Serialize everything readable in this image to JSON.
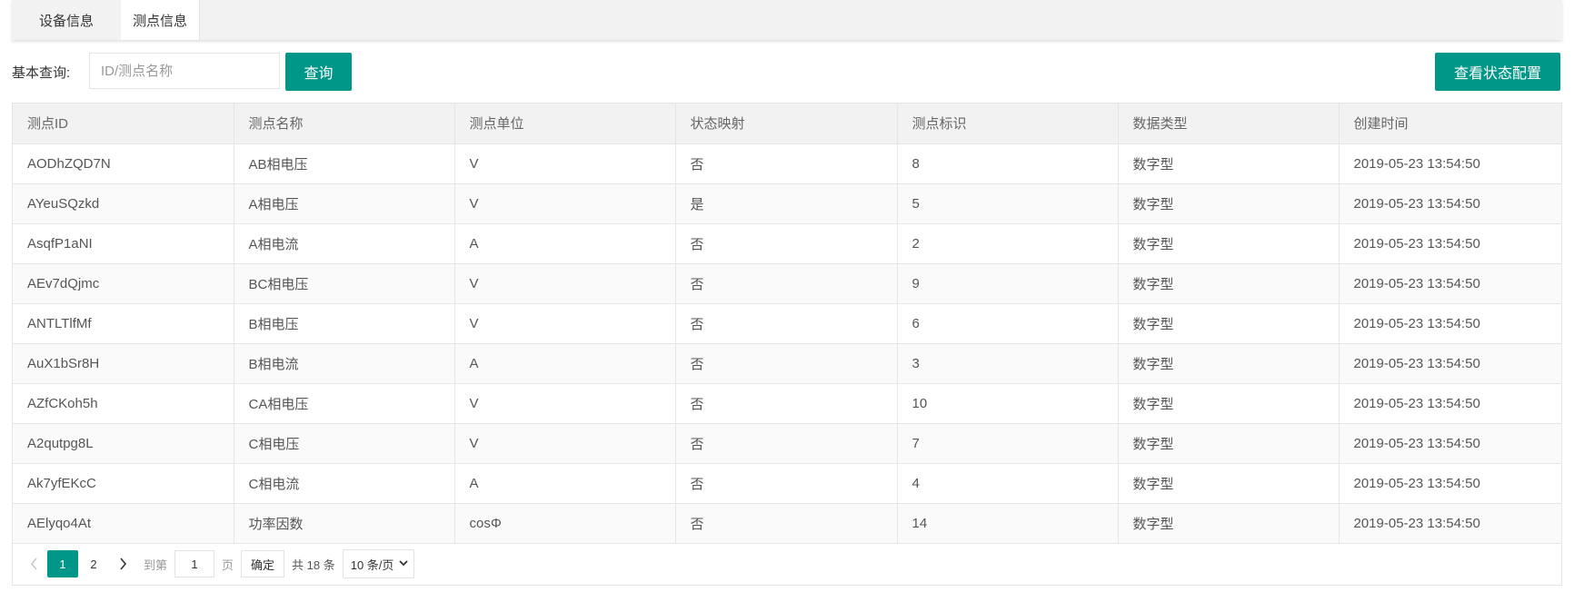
{
  "tabs": [
    {
      "label": "设备信息"
    },
    {
      "label": "测点信息"
    }
  ],
  "query": {
    "label": "基本查询:",
    "placeholder": "ID/测点名称",
    "button_label": "查询"
  },
  "status_config_button": "查看状态配置",
  "table": {
    "headers": [
      "测点ID",
      "测点名称",
      "测点单位",
      "状态映射",
      "测点标识",
      "数据类型",
      "创建时间"
    ],
    "rows": [
      [
        "AODhZQD7N",
        "AB相电压",
        "V",
        "否",
        "8",
        "数字型",
        "2019-05-23 13:54:50"
      ],
      [
        "AYeuSQzkd",
        "A相电压",
        "V",
        "是",
        "5",
        "数字型",
        "2019-05-23 13:54:50"
      ],
      [
        "AsqfP1aNI",
        "A相电流",
        "A",
        "否",
        "2",
        "数字型",
        "2019-05-23 13:54:50"
      ],
      [
        "AEv7dQjmc",
        "BC相电压",
        "V",
        "否",
        "9",
        "数字型",
        "2019-05-23 13:54:50"
      ],
      [
        "ANTLTlfMf",
        "B相电压",
        "V",
        "否",
        "6",
        "数字型",
        "2019-05-23 13:54:50"
      ],
      [
        "AuX1bSr8H",
        "B相电流",
        "A",
        "否",
        "3",
        "数字型",
        "2019-05-23 13:54:50"
      ],
      [
        "AZfCKoh5h",
        "CA相电压",
        "V",
        "否",
        "10",
        "数字型",
        "2019-05-23 13:54:50"
      ],
      [
        "A2qutpg8L",
        "C相电压",
        "V",
        "否",
        "7",
        "数字型",
        "2019-05-23 13:54:50"
      ],
      [
        "Ak7yfEKcC",
        "C相电流",
        "A",
        "否",
        "4",
        "数字型",
        "2019-05-23 13:54:50"
      ],
      [
        "AElyqo4At",
        "功率因数",
        "cosΦ",
        "否",
        "14",
        "数字型",
        "2019-05-23 13:54:50"
      ]
    ]
  },
  "pager": {
    "prev_icon": "chevron-left-icon",
    "next_icon": "chevron-right-icon",
    "pages": [
      "1",
      "2"
    ],
    "current_page": "1",
    "goto_label": "到第",
    "goto_value": "1",
    "page_unit": "页",
    "confirm_label": "确定",
    "total_label": "共 18 条",
    "page_size_label": "10 条/页"
  },
  "colors": {
    "accent": "#009688",
    "header_bg": "#f2f2f2",
    "border": "#e6e6e6"
  }
}
